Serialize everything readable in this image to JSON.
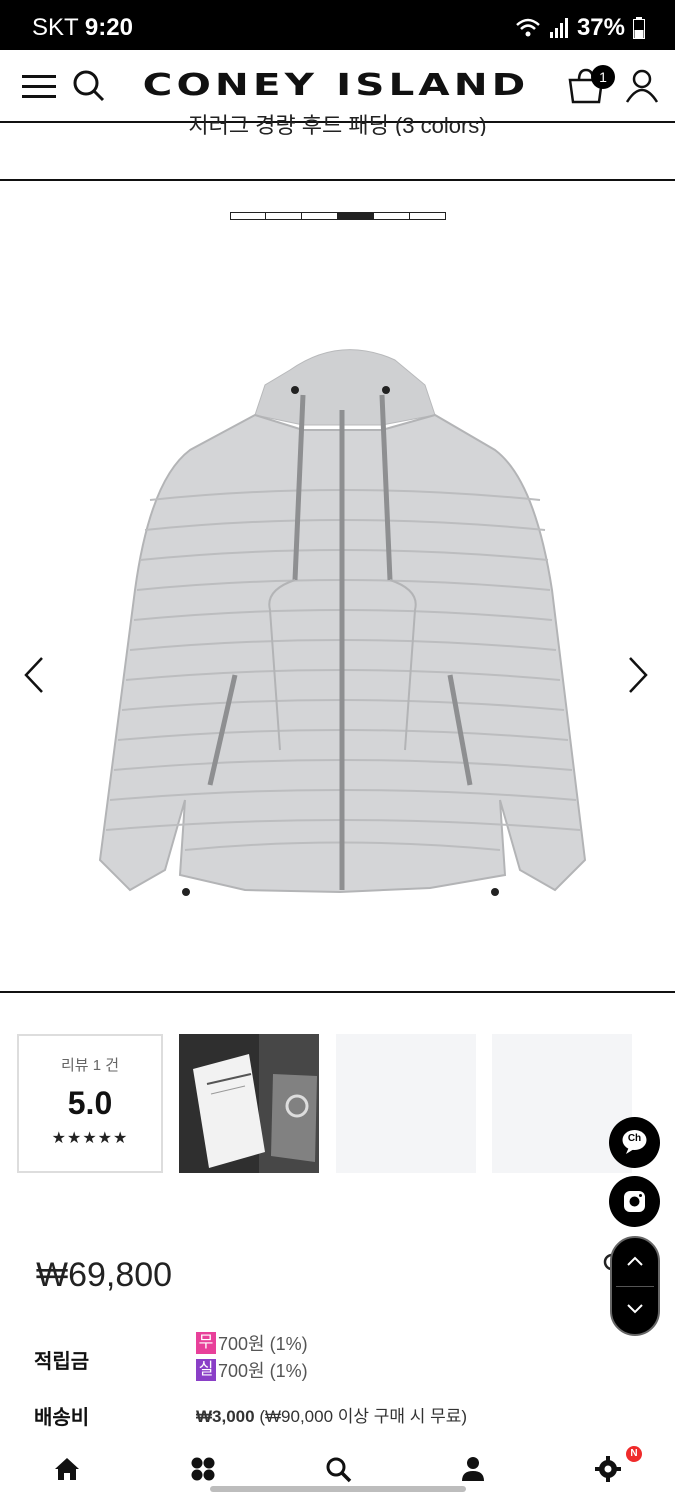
{
  "status_bar": {
    "carrier": "SKT",
    "time": "9:20",
    "battery": "37%"
  },
  "header": {
    "logo": "CONEY ISLAND",
    "cart_count": "1"
  },
  "product": {
    "subtitle": "지러그 경량 후드 패딩 (3 colors)",
    "image_pager": {
      "total": 6,
      "active_index": 3
    },
    "price": "₩69,800"
  },
  "reviews": {
    "label": "리뷰 1 건",
    "score": "5.0",
    "stars": "★★★★★",
    "rating_out_of_5": 5
  },
  "points": {
    "label": "적립금",
    "rows": [
      {
        "badge": "무",
        "badge_color": "#e8409a",
        "text": "700원 (1%)"
      },
      {
        "badge": "실",
        "badge_color": "#8a3fc7",
        "text": "700원 (1%)"
      }
    ]
  },
  "shipping": {
    "label": "배송비",
    "fee": "₩3,000",
    "note": "(₩90,000 이상 구매 시 무료)"
  },
  "floating": {
    "chat_label": "Ch"
  },
  "bottom_nav": {
    "settings_badge": "N"
  }
}
